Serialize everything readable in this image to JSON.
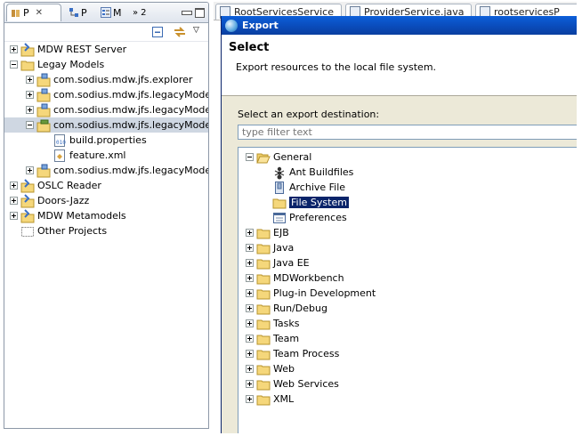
{
  "left_panel": {
    "tabs": [
      {
        "label": "P",
        "icon": "package-explorer-icon"
      },
      {
        "label": "P",
        "icon": "hierarchy-icon"
      },
      {
        "label": "M",
        "icon": "outline-icon"
      },
      {
        "label": "2",
        "icon": "overflow-chevron-icon"
      }
    ],
    "tree": [
      {
        "label": "MDW REST Server",
        "expander": "plus",
        "icon": "project-icon",
        "level": 0
      },
      {
        "label": "Legay Models",
        "expander": "minus",
        "icon": "folder-icon",
        "level": 0
      },
      {
        "label": "com.sodius.mdw.jfs.explorer",
        "expander": "plus",
        "icon": "plugin-project-icon",
        "level": 1
      },
      {
        "label": "com.sodius.mdw.jfs.legacyModels",
        "expander": "plus",
        "icon": "plugin-project-icon",
        "level": 1
      },
      {
        "label": "com.sodius.mdw.jfs.legacyModels",
        "expander": "plus",
        "icon": "plugin-project-icon",
        "level": 1
      },
      {
        "label": "com.sodius.mdw.jfs.legacyModels",
        "expander": "minus",
        "icon": "feature-project-icon",
        "level": 1,
        "selected": true
      },
      {
        "label": "build.properties",
        "expander": "none",
        "icon": "properties-file-icon",
        "level": 2
      },
      {
        "label": "feature.xml",
        "expander": "none",
        "icon": "feature-file-icon",
        "level": 2
      },
      {
        "label": "com.sodius.mdw.jfs.legacyModels",
        "expander": "plus",
        "icon": "plugin-project-icon",
        "level": 1
      },
      {
        "label": "OSLC Reader",
        "expander": "plus",
        "icon": "project-icon",
        "level": 0
      },
      {
        "label": "Doors-Jazz",
        "expander": "plus",
        "icon": "project-icon",
        "level": 0
      },
      {
        "label": "MDW Metamodels",
        "expander": "plus",
        "icon": "project-icon",
        "level": 0
      },
      {
        "label": "Other Projects",
        "expander": "none",
        "icon": "working-set-icon",
        "level": 0
      }
    ]
  },
  "editor_tabs": [
    {
      "label": "RootServicesService"
    },
    {
      "label": "ProviderService.java"
    },
    {
      "label": "rootservicesP"
    }
  ],
  "dialog": {
    "title": "Export",
    "header_title": "Select",
    "header_desc": "Export resources to the local file system.",
    "select_label": "Select an export destination:",
    "filter_placeholder": "type filter text",
    "tree": [
      {
        "label": "General",
        "expander": "minus",
        "icon": "folder-open-icon",
        "level": 0
      },
      {
        "label": "Ant Buildfiles",
        "expander": "none",
        "icon": "ant-icon",
        "level": 1
      },
      {
        "label": "Archive File",
        "expander": "none",
        "icon": "archive-icon",
        "level": 1
      },
      {
        "label": "File System",
        "expander": "none",
        "icon": "folder-icon",
        "level": 1,
        "selected": true
      },
      {
        "label": "Preferences",
        "expander": "none",
        "icon": "preferences-icon",
        "level": 1
      },
      {
        "label": "EJB",
        "expander": "plus",
        "icon": "folder-icon",
        "level": 0
      },
      {
        "label": "Java",
        "expander": "plus",
        "icon": "folder-icon",
        "level": 0
      },
      {
        "label": "Java EE",
        "expander": "plus",
        "icon": "folder-icon",
        "level": 0
      },
      {
        "label": "MDWorkbench",
        "expander": "plus",
        "icon": "folder-icon",
        "level": 0
      },
      {
        "label": "Plug-in Development",
        "expander": "plus",
        "icon": "folder-icon",
        "level": 0
      },
      {
        "label": "Run/Debug",
        "expander": "plus",
        "icon": "folder-icon",
        "level": 0
      },
      {
        "label": "Tasks",
        "expander": "plus",
        "icon": "folder-icon",
        "level": 0
      },
      {
        "label": "Team",
        "expander": "plus",
        "icon": "folder-icon",
        "level": 0
      },
      {
        "label": "Team Process",
        "expander": "plus",
        "icon": "folder-icon",
        "level": 0
      },
      {
        "label": "Web",
        "expander": "plus",
        "icon": "folder-icon",
        "level": 0
      },
      {
        "label": "Web Services",
        "expander": "plus",
        "icon": "folder-icon",
        "level": 0
      },
      {
        "label": "XML",
        "expander": "plus",
        "icon": "folder-icon",
        "level": 0
      }
    ]
  },
  "colors": {
    "titlebar": "#0a4ab8",
    "selection": "#0a246a",
    "folder": "#f5d77b"
  }
}
